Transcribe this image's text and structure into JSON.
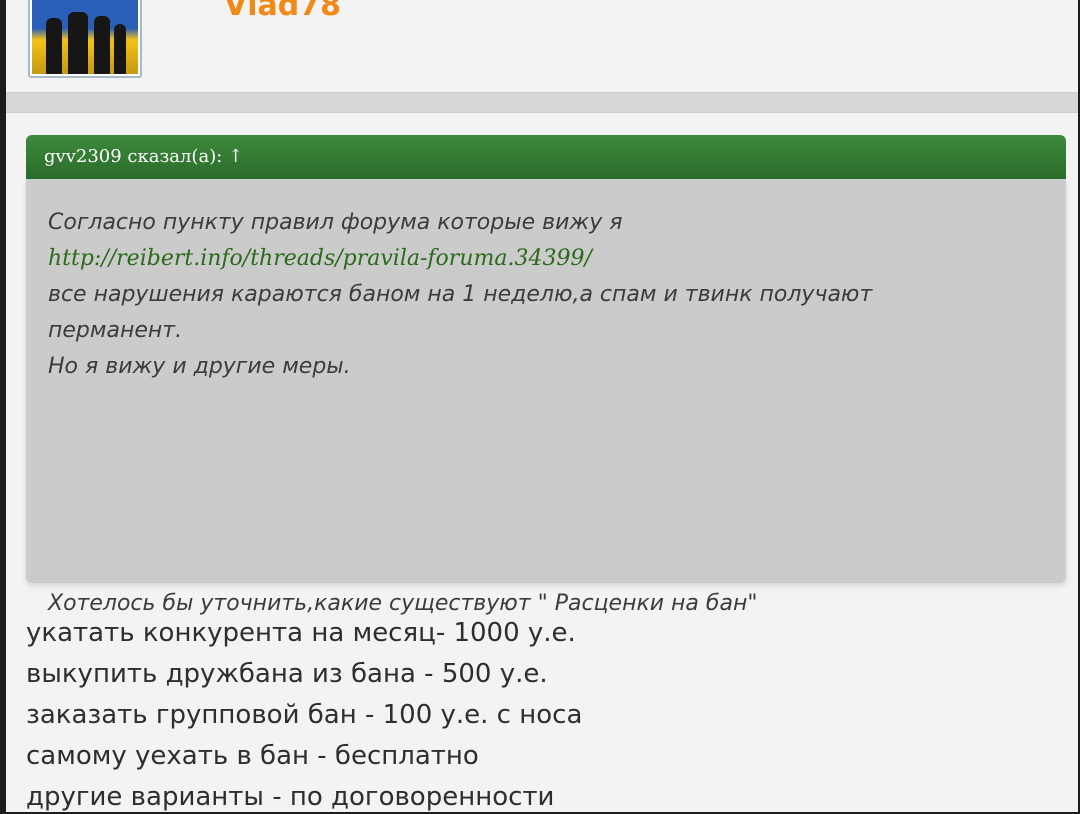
{
  "post_top": {
    "username": "Vlad78"
  },
  "quote": {
    "header": "gvv2309 сказал(а): ↑",
    "lines": [
      "Согласно пункту правил форума которые вижу я",
      "http://reibert.info/threads/pravila-foruma.34399/",
      "все нарушения караются баном на 1 неделю,а спам и твинк получают",
      "перманент.",
      "Но я вижу и другие меры."
    ],
    "final_line": "Хотелось бы уточнить,какие существуют \" Расценки на бан\""
  },
  "reply": {
    "lines": [
      "укатать конкурента на месяц- 1000 у.е.",
      "выкупить дружбана из бана - 500 у.е.",
      "заказать групповой бан - 100 у.е. с носа",
      "самому уехать в бан - бесплатно",
      "другие варианты - по договоренности"
    ]
  },
  "colors": {
    "username": "#f08a16",
    "quote_header_bg": "#2b6c2b",
    "quote_bg": "#cbcbcb",
    "link": "#2a6a1a"
  }
}
